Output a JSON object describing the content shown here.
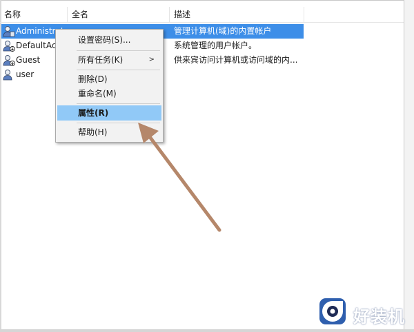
{
  "columns": {
    "name": "名称",
    "fullname": "全名",
    "description": "描述"
  },
  "users": [
    {
      "name": "Administrat",
      "description": "管理计算机(域)的内置帐户",
      "selected": true
    },
    {
      "name": "DefaultAcc",
      "description": "系统管理的用户帐户。",
      "selected": false
    },
    {
      "name": "Guest",
      "description": "供来宾访问计算机或访问域的内...",
      "selected": false
    },
    {
      "name": "user",
      "description": "",
      "selected": false
    }
  ],
  "context_menu": {
    "items": [
      {
        "label": "设置密码(S)..."
      },
      {
        "label": "所有任务(K)",
        "has_submenu": true
      },
      {
        "label": "删除(D)"
      },
      {
        "label": "重命名(M)"
      },
      {
        "label": "属性(R)",
        "highlighted": true
      },
      {
        "label": "帮助(H)"
      }
    ],
    "submenu_arrow": ">"
  },
  "watermark": {
    "text": "好装机"
  },
  "colors": {
    "selection": "#3d8ee8",
    "menu_highlight": "#91c9f7",
    "annotation_arrow": "#b5876a"
  },
  "icons": {
    "user": "user-account-icon",
    "submenu": "chevron-right-icon",
    "logo": "eye-logo-icon"
  }
}
